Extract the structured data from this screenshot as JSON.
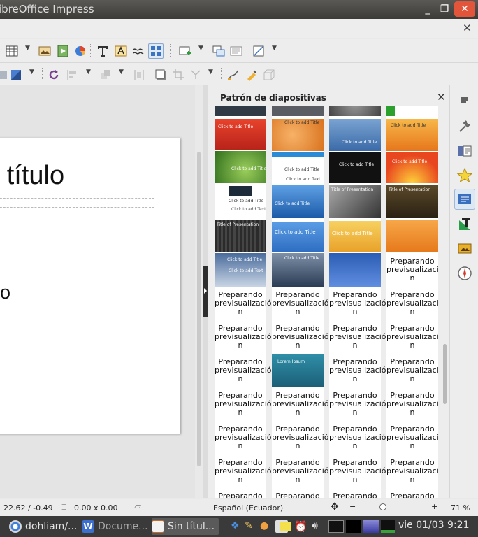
{
  "window": {
    "title": "ibreOffice Impress"
  },
  "window_buttons": {
    "minimize": "_",
    "maximize": "❐",
    "close": "✕"
  },
  "document": {
    "close_glyph": "✕"
  },
  "slide": {
    "title_text": "n título",
    "body_text": "xto"
  },
  "sidebar": {
    "panel_title": "Patrón de diapositivas",
    "close_glyph": "✕",
    "preparing_line1": "Preparando",
    "preparing_line2": "previsualizació",
    "preparing_line3": "n",
    "thumb_click_title": "Click to add Title",
    "thumb_click_text": "Click to add Text",
    "thumb_lorem": "Lorem Ipsum",
    "thumb_presentation": "Title of Presentation"
  },
  "statusbar": {
    "position": "22.62 / -0.49",
    "size": "0.00 x 0.00",
    "language": "Español (Ecuador)",
    "zoom_minus": "−",
    "zoom_plus": "+",
    "zoom": "71 %"
  },
  "taskbar": {
    "tasks": [
      {
        "label": "dohliam/..."
      },
      {
        "label": "Docume..."
      },
      {
        "label": "Sin títul..."
      }
    ],
    "clock": "vie 01/03  9:21"
  },
  "colors": {
    "titlebar": "#3c3b37",
    "close_button": "#e2553b",
    "taskbar": "#3a3a3a",
    "accent": "#9fb8d8"
  }
}
